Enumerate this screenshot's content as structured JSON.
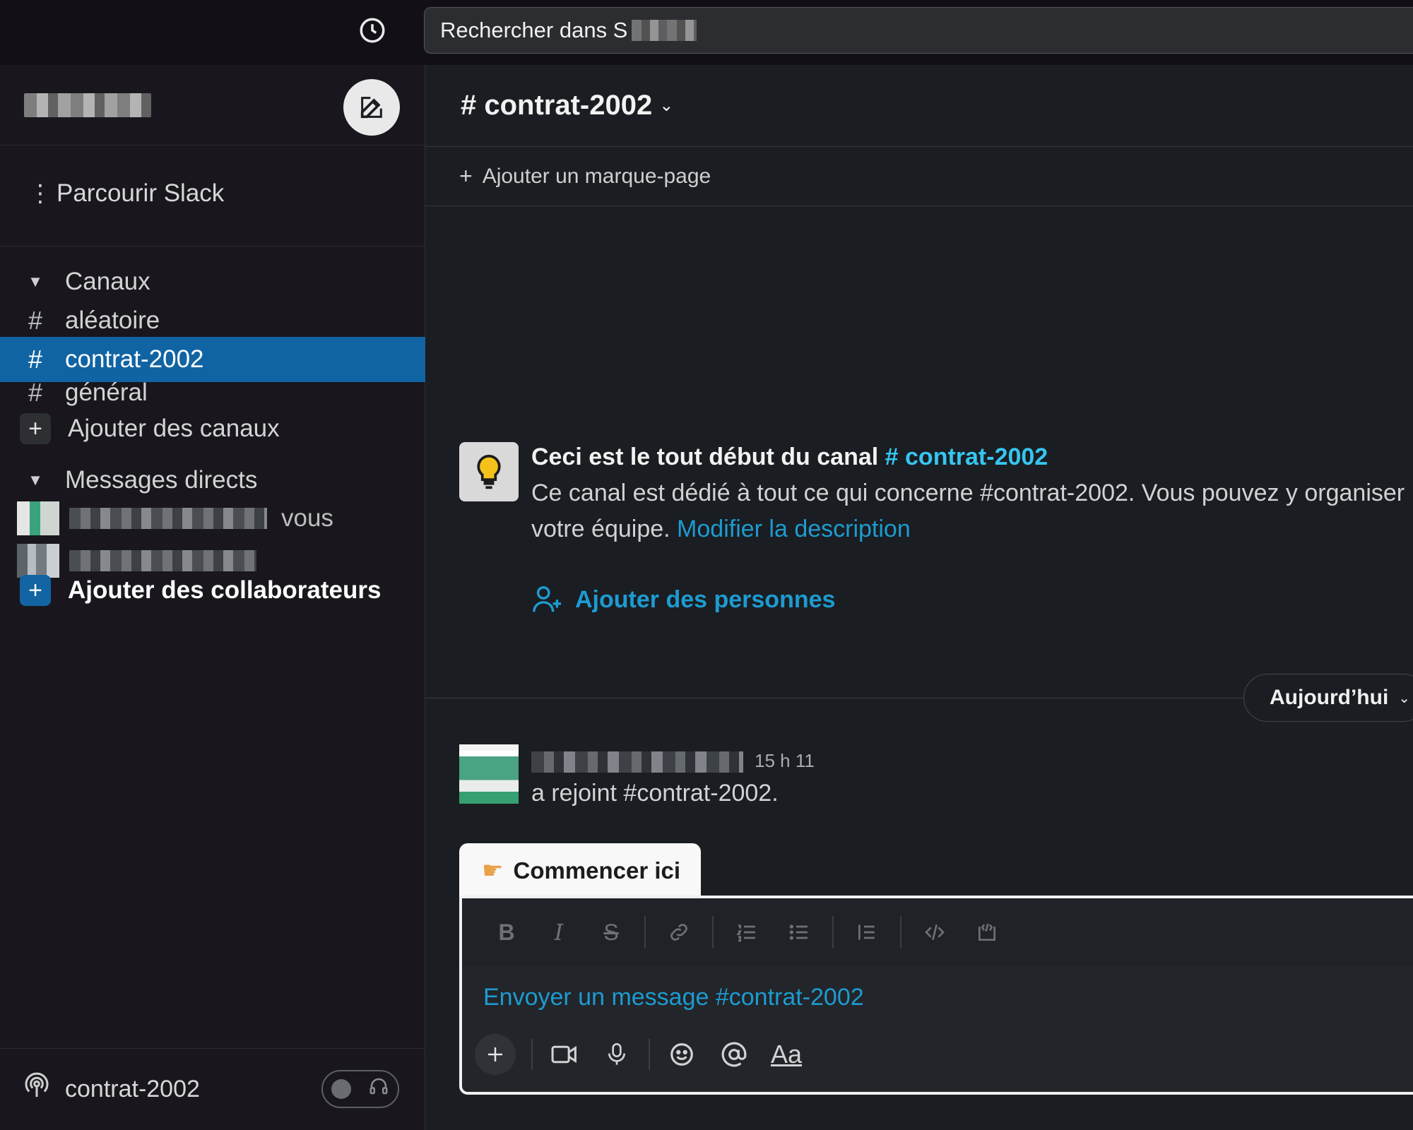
{
  "search": {
    "placeholder": "Rechercher dans S"
  },
  "sidebar": {
    "browse_label": "Parcourir Slack",
    "channels_section": "Canaux",
    "channels": [
      {
        "label": "aléatoire"
      },
      {
        "label": "contrat-2002"
      },
      {
        "label": "général"
      }
    ],
    "add_channels": "Ajouter des canaux",
    "dm_section": "Messages directs",
    "dm_self_suffix": "vous",
    "add_collaborators": "Ajouter des collaborateurs",
    "huddle_channel": "contrat-2002"
  },
  "channel": {
    "name": "contrat-2002",
    "bookmark": "Ajouter un marque-page",
    "intro_title": "Ceci est le tout début du canal",
    "intro_link": "# contrat-2002",
    "intro_desc": "Ce canal est dédié à tout ce qui concerne #contrat-2002. Vous pouvez y organiser",
    "intro_desc2": "votre équipe.",
    "edit_description": "Modifier la description",
    "add_people": "Ajouter des personnes"
  },
  "timeline": {
    "day_label": "Aujourd’hui",
    "message_time": "15 h 11",
    "message_text": "a rejoint #contrat-2002."
  },
  "composer": {
    "start_tab": "Commencer ici",
    "placeholder": "Envoyer un message #contrat-2002",
    "format_label": "Aa"
  },
  "colors": {
    "accent": "#1164a3",
    "link": "#1d9bd1",
    "background": "#1a1d21"
  }
}
